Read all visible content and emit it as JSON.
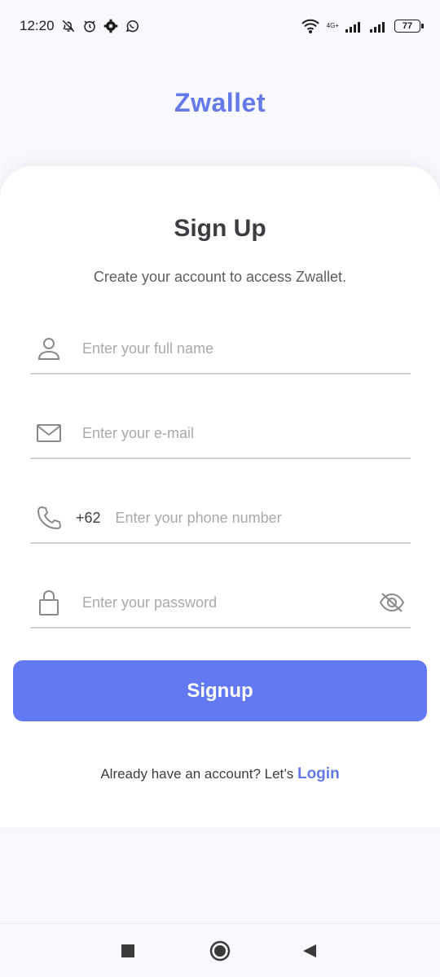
{
  "status_bar": {
    "time": "12:20",
    "network_label": "4G+",
    "battery": "77",
    "icons": [
      "bell-off-icon",
      "alarm-icon",
      "gear-icon",
      "whatsapp-icon",
      "wifi-icon",
      "signal-icon",
      "signal-icon",
      "battery-icon"
    ]
  },
  "brand": {
    "name": "Zwallet",
    "color": "#6379e8"
  },
  "card": {
    "title": "Sign Up",
    "subtitle": "Create your account to access Zwallet."
  },
  "form": {
    "name": {
      "placeholder": "Enter your full name",
      "value": "",
      "icon": "user-icon"
    },
    "email": {
      "placeholder": "Enter your e-mail",
      "value": "",
      "icon": "mail-icon"
    },
    "phone": {
      "prefix": "+62",
      "placeholder": "Enter your phone number",
      "value": "",
      "icon": "phone-icon"
    },
    "password": {
      "placeholder": "Enter your password",
      "value": "",
      "icon": "lock-icon",
      "toggle_icon": "eye-off-icon"
    }
  },
  "signup_button": {
    "label": "Signup",
    "color": "#6379f4"
  },
  "login": {
    "prompt": "Already have an account? Let’s",
    "link_label": "Login"
  },
  "nav": {
    "icons": [
      "recents-icon",
      "home-icon",
      "back-icon"
    ]
  }
}
